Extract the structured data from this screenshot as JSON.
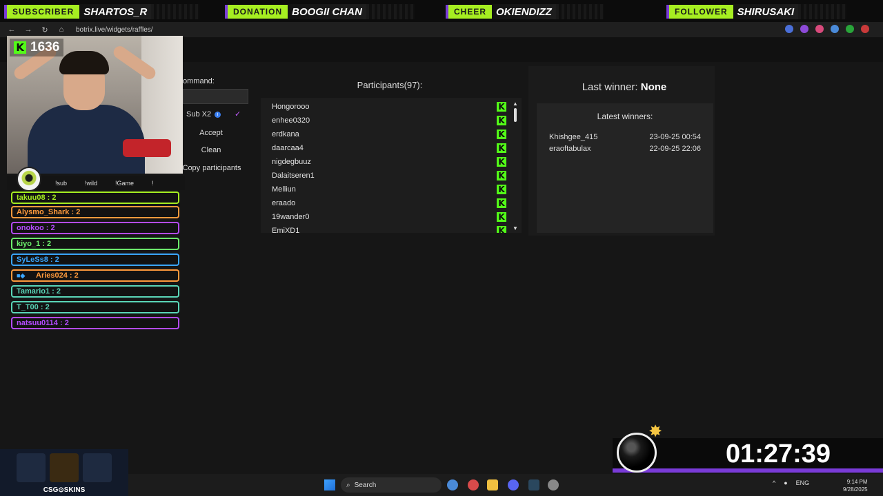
{
  "alerts": [
    {
      "label": "SUBSCRIBER",
      "value": "SHARTOS_R"
    },
    {
      "label": "DONATION",
      "value": "BOOGII CHAN"
    },
    {
      "label": "CHEER",
      "value": "OKIENDIZZ"
    },
    {
      "label": "FOLLOWER",
      "value": "SHIRUSAKI"
    }
  ],
  "browser": {
    "url": "botrix.live/widgets/raffles/"
  },
  "viewer_count": "1636",
  "raffle": {
    "command_label": "ommand:",
    "command_value": "",
    "sub_x2_label": "Sub X2",
    "sub_x2_checked": "✓",
    "accept_label": "Accept",
    "clean_label": "Clean",
    "copy_label": "Copy participants"
  },
  "participants": {
    "title": "Participants(97):",
    "list": [
      "Hongorooo",
      "enhee0320",
      "erdkana",
      "daarcaa4",
      "nigdegbuuz",
      "Dalaitseren1",
      "Melliun",
      "eraado",
      "19wander0",
      "EmiXD1"
    ]
  },
  "last_winner": {
    "label": "Last winner:",
    "value": "None"
  },
  "latest_winners": {
    "title": "Latest winners:",
    "items": [
      {
        "name": "Khishgee_415",
        "date": "23-09-25 00:54"
      },
      {
        "name": "eraoftabulax",
        "date": "22-09-25 22:06"
      }
    ]
  },
  "stream_commands": [
    "!sub",
    "!wild",
    "!Game",
    "!"
  ],
  "chat": [
    {
      "text": "takuu08 : 2",
      "color": "#a6ee21"
    },
    {
      "text": "Alysmo_Shark : 2",
      "color": "#ff9a3c"
    },
    {
      "text": "onokoo : 2",
      "color": "#b44bff"
    },
    {
      "text": "kiyo_1 : 2",
      "color": "#6cf06c"
    },
    {
      "text": "SyLeSs8 : 2",
      "color": "#3aa6ff"
    },
    {
      "text": "Aries024 : 2",
      "color": "#ff9a3c"
    },
    {
      "text": "Tamario1 : 2",
      "color": "#5ad6b8"
    },
    {
      "text": "T_T00 : 2",
      "color": "#5ad6b8"
    },
    {
      "text": "natsuu0114 : 2",
      "color": "#b44bff"
    }
  ],
  "skins_brand": "CSG⊙SKINS",
  "timer": "01:27:39",
  "taskbar": {
    "search": "Search",
    "lang": "ENG",
    "time": "9:14 PM",
    "date": "9/28/2025"
  }
}
